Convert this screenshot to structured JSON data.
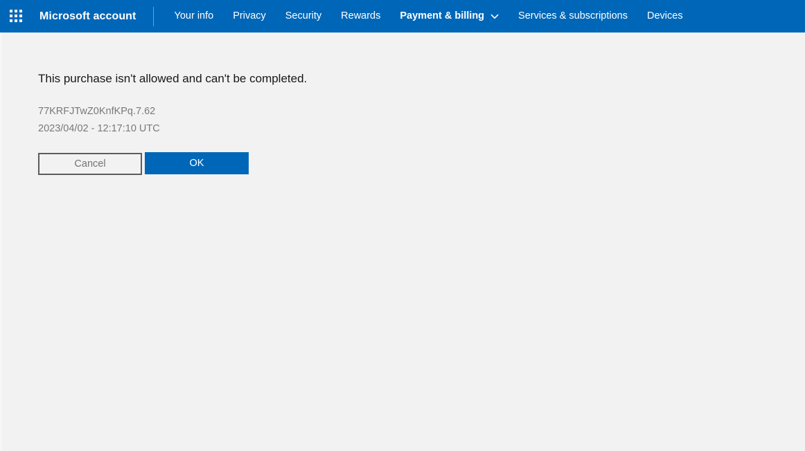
{
  "page": {
    "background_color": "#f2f2f2"
  },
  "topnav": {
    "background_color": "#0067b8",
    "app_launcher_icon": "waffle-icon",
    "brand": "Microsoft account",
    "items": [
      {
        "label": "Your info",
        "active": false,
        "icon": ""
      },
      {
        "label": "Privacy",
        "active": false,
        "icon": ""
      },
      {
        "label": "Security",
        "active": false,
        "icon": ""
      },
      {
        "label": "Rewards",
        "active": false,
        "icon": ""
      },
      {
        "label": "Payment & billing",
        "active": true,
        "icon": "chevron-down-icon"
      },
      {
        "label": "Services & subscriptions",
        "active": false,
        "icon": ""
      },
      {
        "label": "Devices",
        "active": false,
        "icon": ""
      }
    ]
  },
  "main": {
    "message": "This purchase isn't allowed and can't be completed.",
    "reference_code": "77KRFJTwZ0KnfKPq.7.62",
    "timestamp": "2023/04/02 - 12:17:10 UTC",
    "buttons": {
      "cancel_label": "Cancel",
      "ok_label": "OK",
      "ok_color": "#0067b8",
      "cancel_border_color": "#5c5c5c",
      "cancel_text_color": "#737373"
    }
  }
}
